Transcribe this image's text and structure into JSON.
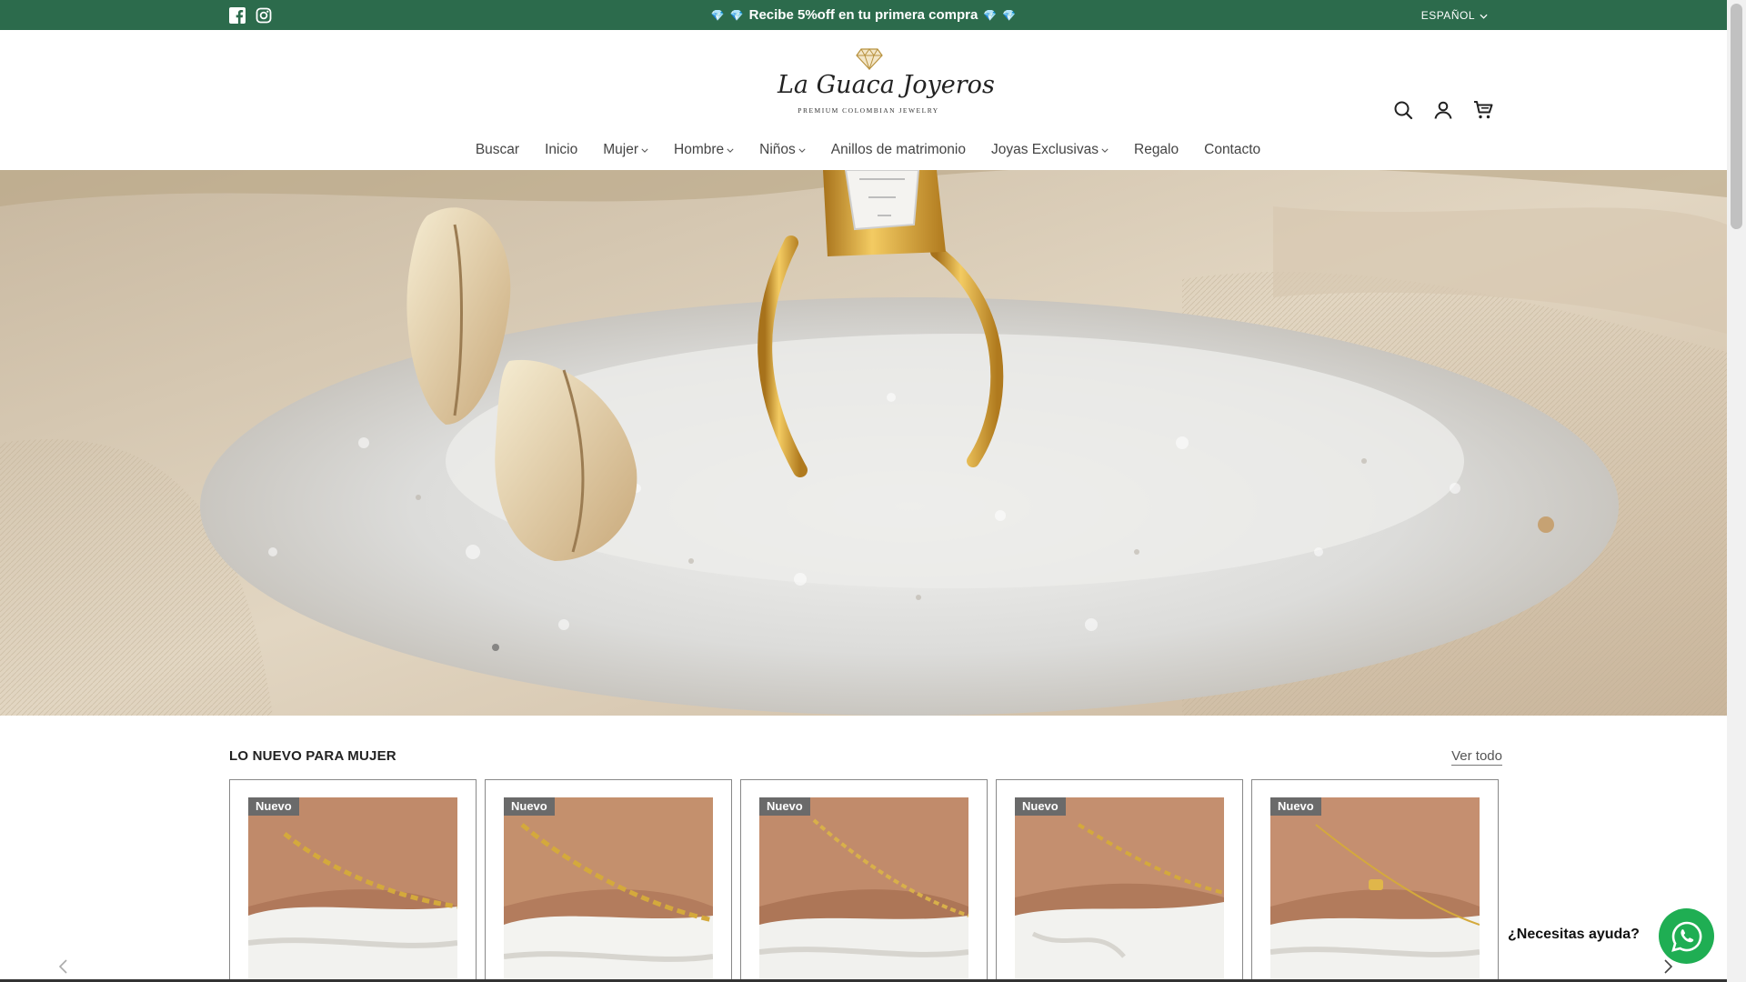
{
  "announcement": {
    "text": "Recibe 5%off en tu primera compra",
    "gem_glyph": "💎",
    "bg_color": "#2c6b4c",
    "language": "ESPAÑOL"
  },
  "social": {
    "facebook_icon": "facebook-icon",
    "instagram_icon": "instagram-icon"
  },
  "brand": {
    "name": "La Guaca Joyeros",
    "tagline": "PREMIUM COLOMBIAN JEWELRY"
  },
  "header_icons": [
    "search-icon",
    "account-icon",
    "cart-icon"
  ],
  "nav": {
    "items": [
      {
        "label": "Buscar",
        "dropdown": false
      },
      {
        "label": "Inicio",
        "dropdown": false
      },
      {
        "label": "Mujer",
        "dropdown": true
      },
      {
        "label": "Hombre",
        "dropdown": true
      },
      {
        "label": "Niños",
        "dropdown": true
      },
      {
        "label": "Anillos de matrimonio",
        "dropdown": false
      },
      {
        "label": "Joyas Exclusivas",
        "dropdown": true
      },
      {
        "label": "Regalo",
        "dropdown": false
      },
      {
        "label": "Contacto",
        "dropdown": false
      }
    ]
  },
  "section": {
    "title": "LO NUEVO PARA MUJER",
    "view_all": "Ver todo"
  },
  "products": [
    {
      "badge": "Nuevo"
    },
    {
      "badge": "Nuevo"
    },
    {
      "badge": "Nuevo"
    },
    {
      "badge": "Nuevo"
    },
    {
      "badge": "Nuevo"
    }
  ],
  "chat": {
    "help_text": "¿Necesitas ayuda?",
    "whatsapp_color": "#1fae53"
  }
}
